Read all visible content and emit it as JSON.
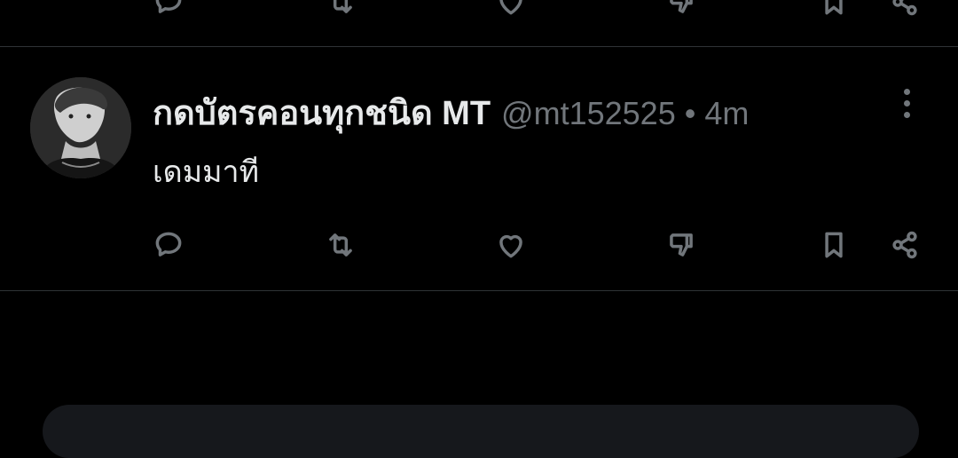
{
  "tweet": {
    "display_name": "กดบัตรคอนทุกชนิด MT",
    "handle": "@mt152525",
    "separator": "•",
    "time": "4m",
    "text": "เดมมาที"
  },
  "actions": [
    "reply-icon",
    "retweet-icon",
    "like-icon",
    "dislike-icon",
    "bookmark-icon",
    "share-icon"
  ],
  "colors": {
    "background": "#000000",
    "text": "#e7e9ea",
    "muted": "#71767b",
    "divider": "#2f3336"
  }
}
